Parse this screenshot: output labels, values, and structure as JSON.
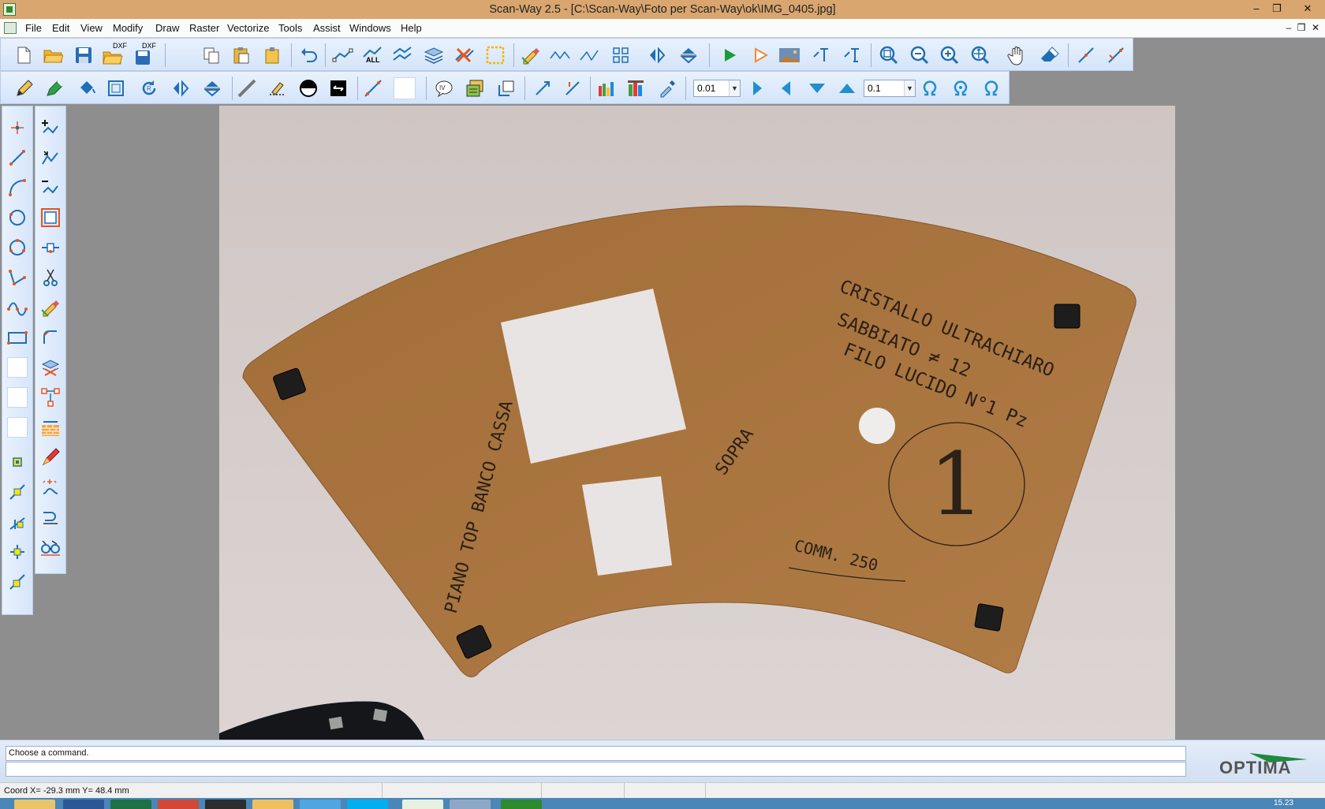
{
  "window": {
    "title": "Scan-Way 2.5 - [C:\\Scan-Way\\Foto per Scan-Way\\ok\\IMG_0405.jpg]",
    "minimize": "–",
    "maximize": "❐",
    "close": "✕"
  },
  "menu": {
    "items": [
      "File",
      "Edit",
      "View",
      "Modify",
      "Draw",
      "Raster",
      "Vectorize",
      "Tools",
      "Assist",
      "Windows",
      "Help"
    ],
    "mdi_minimize": "–",
    "mdi_restore": "❐",
    "mdi_close": "✕"
  },
  "toolbar": {
    "dxf_open_label": "DXF",
    "dxf_save_label": "DXF",
    "select_all_label": "ALL",
    "precision_value": "0.01",
    "step_value": "0.1"
  },
  "photo_annotations": {
    "line1": "CRISTALLO ULTRACHIARO",
    "line2": "SABBIATO ≠ 12",
    "line3": "FILO LUCIDO    N°1 Pz",
    "circle_number": "1",
    "commessa": "COMM. 250",
    "side_text": "PIANO TOP BANCO CASSA",
    "sopra": "SOPRA"
  },
  "command": {
    "prompt": "Choose a command.",
    "input": ""
  },
  "logo_text": "OPTIMA",
  "status": {
    "coord": "Coord  X= -29.3 mm  Y= 48.4 mm"
  },
  "taskbar": {
    "clock": "15.23"
  },
  "colors": {
    "titlebar": "#d9a66f",
    "toolbar_bg": "#dbe8fb",
    "icon_blue": "#1f6fb5",
    "icon_green": "#1e9a3a",
    "board": "#a8753f",
    "logo_green": "#1e8a3e",
    "logo_gray": "#555"
  }
}
